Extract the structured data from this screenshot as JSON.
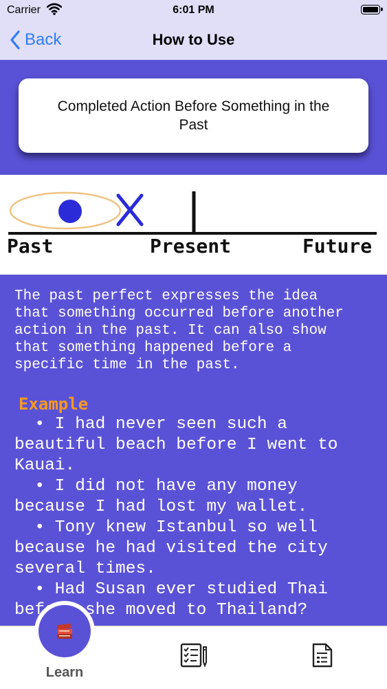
{
  "status_bar": {
    "carrier": "Carrier",
    "time": "6:01 PM"
  },
  "nav": {
    "back_label": "Back",
    "title": "How to Use"
  },
  "card": {
    "title": "Completed Action Before Something in the Past"
  },
  "timeline": {
    "labels": {
      "past": "Past",
      "present": "Present",
      "future": "Future"
    }
  },
  "description": "The past perfect expresses the idea\nthat something occurred before another\naction in the past. It can also show\nthat something happened before a\nspecific time in the past.",
  "example_heading": "Example",
  "examples": [
    "  • I had never seen such a\nbeautiful beach before I went to\nKauai.",
    "  • I did not have any money\nbecause I had lost my wallet.",
    "  • Tony knew Istanbul so well\nbecause he had visited the city\nseveral times.",
    "  • Had Susan ever studied Thai\nbefore she moved to Thailand?"
  ],
  "tabs": {
    "learn_label": "Learn"
  },
  "colors": {
    "background": "#5a52d6",
    "nav_bg": "#e1dff8",
    "accent": "#2f7cf6",
    "example_heading": "#f59a23"
  },
  "icons": [
    "wifi-icon",
    "battery-icon",
    "chevron-left-icon",
    "books-icon",
    "checklist-pencil-icon",
    "document-list-icon"
  ]
}
